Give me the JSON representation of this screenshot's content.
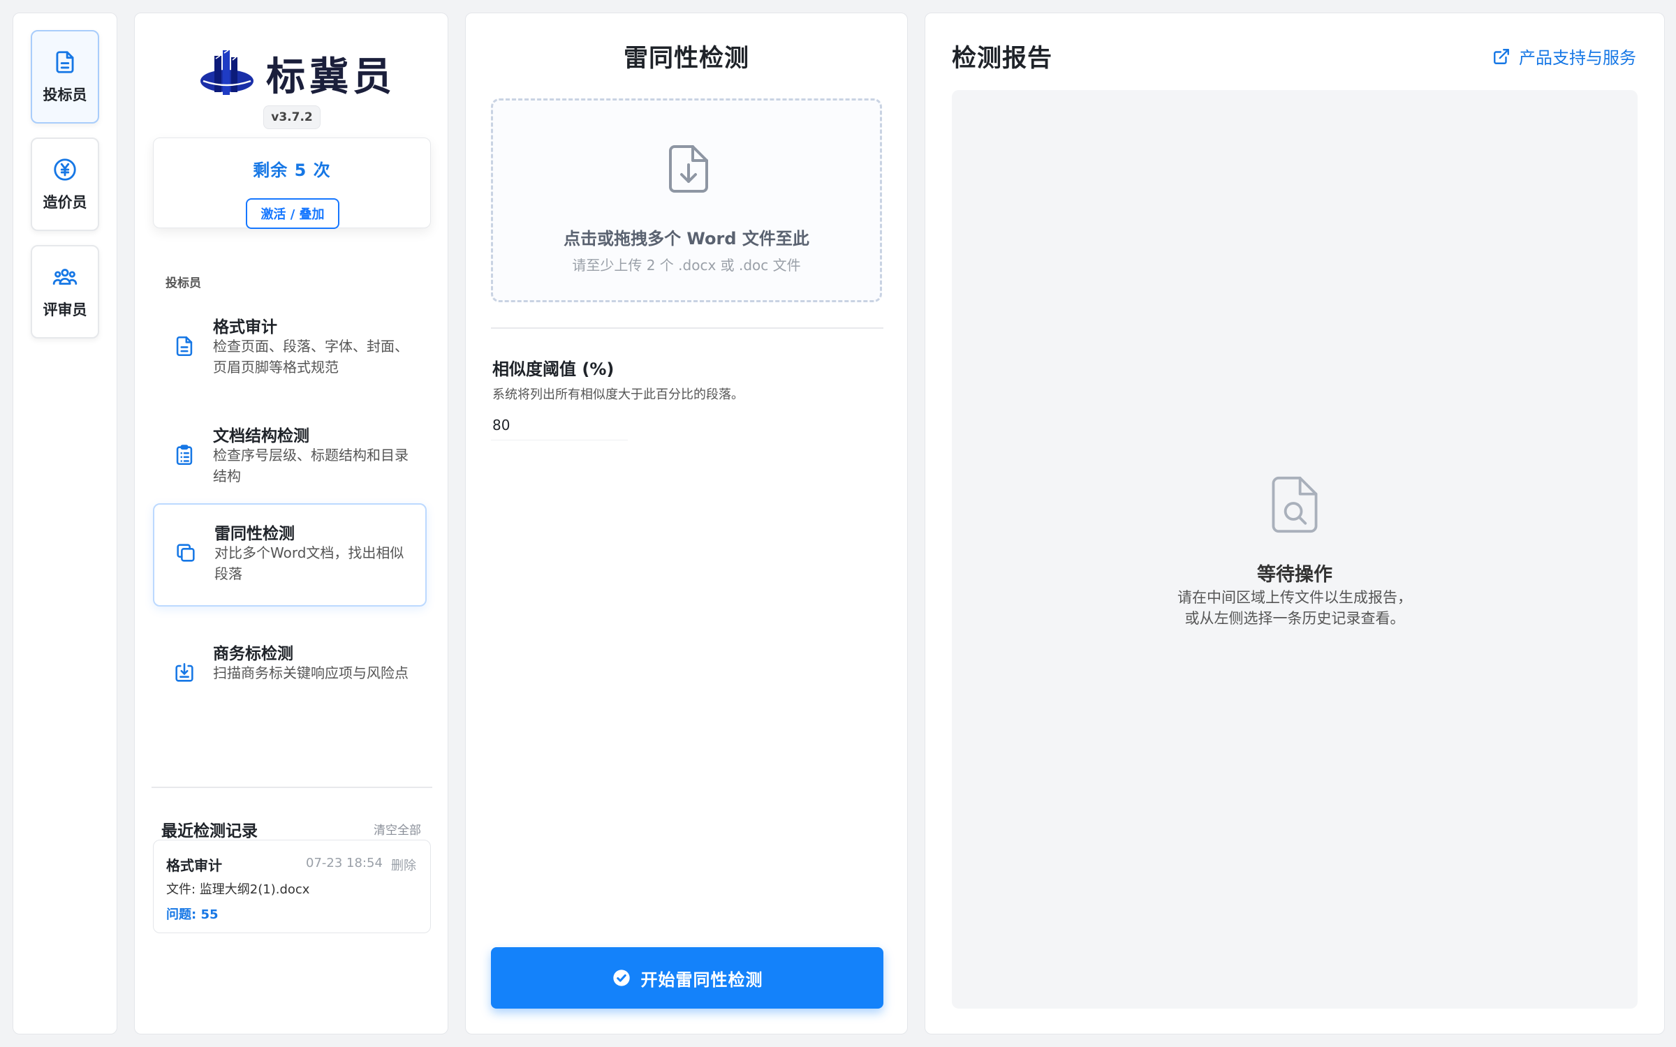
{
  "roles": [
    {
      "label": "投标员",
      "icon": "document-icon",
      "active": true
    },
    {
      "label": "造价员",
      "icon": "yen-icon",
      "active": false
    },
    {
      "label": "评审员",
      "icon": "users-icon",
      "active": false
    }
  ],
  "brand": {
    "name": "标冀员",
    "version": "v3.7.2",
    "logo": "building-logo-icon"
  },
  "quota": {
    "remaining": "剩余 5 次",
    "activate_label": "激活 / 叠加"
  },
  "nav": {
    "section_label": "投标员",
    "items": [
      {
        "title": "格式审计",
        "desc": "检查页面、段落、字体、封面、页眉页脚等格式规范",
        "icon": "file-text-icon"
      },
      {
        "title": "文档结构检测",
        "desc": "检查序号层级、标题结构和目录结构",
        "icon": "clipboard-list-icon"
      },
      {
        "title": "雷同性检测",
        "desc": "对比多个Word文档，找出相似段落",
        "icon": "copy-icon",
        "active": true
      },
      {
        "title": "商务标检测",
        "desc": "扫描商务标关键响应项与风险点",
        "icon": "tray-download-icon"
      }
    ]
  },
  "recent": {
    "title": "最近检测记录",
    "clear_label": "清空全部",
    "records": [
      {
        "type": "格式审计",
        "time": "07-23 18:54",
        "delete_label": "删除",
        "file": "文件: 监理大纲2(1).docx",
        "issues": "问题: 55"
      }
    ]
  },
  "center": {
    "title": "雷同性检测",
    "upload": {
      "main": "点击或拖拽多个 Word 文件至此",
      "sub": "请至少上传 2 个 .docx 或 .doc 文件"
    },
    "threshold": {
      "label": "相似度阈值 (%)",
      "hint": "系统将列出所有相似度大于此百分比的段落。",
      "value": "80"
    },
    "start_label": "开始雷同性检测"
  },
  "report": {
    "title": "检测报告",
    "support_label": "产品支持与服务",
    "empty_title": "等待操作",
    "empty_desc_1": "请在中间区域上传文件以生成报告，",
    "empty_desc_2": "或从左侧选择一条历史记录查看。"
  },
  "colors": {
    "accent": "#1677ff",
    "button": "#1482fa",
    "brand_dark": "#1b1f3b"
  }
}
